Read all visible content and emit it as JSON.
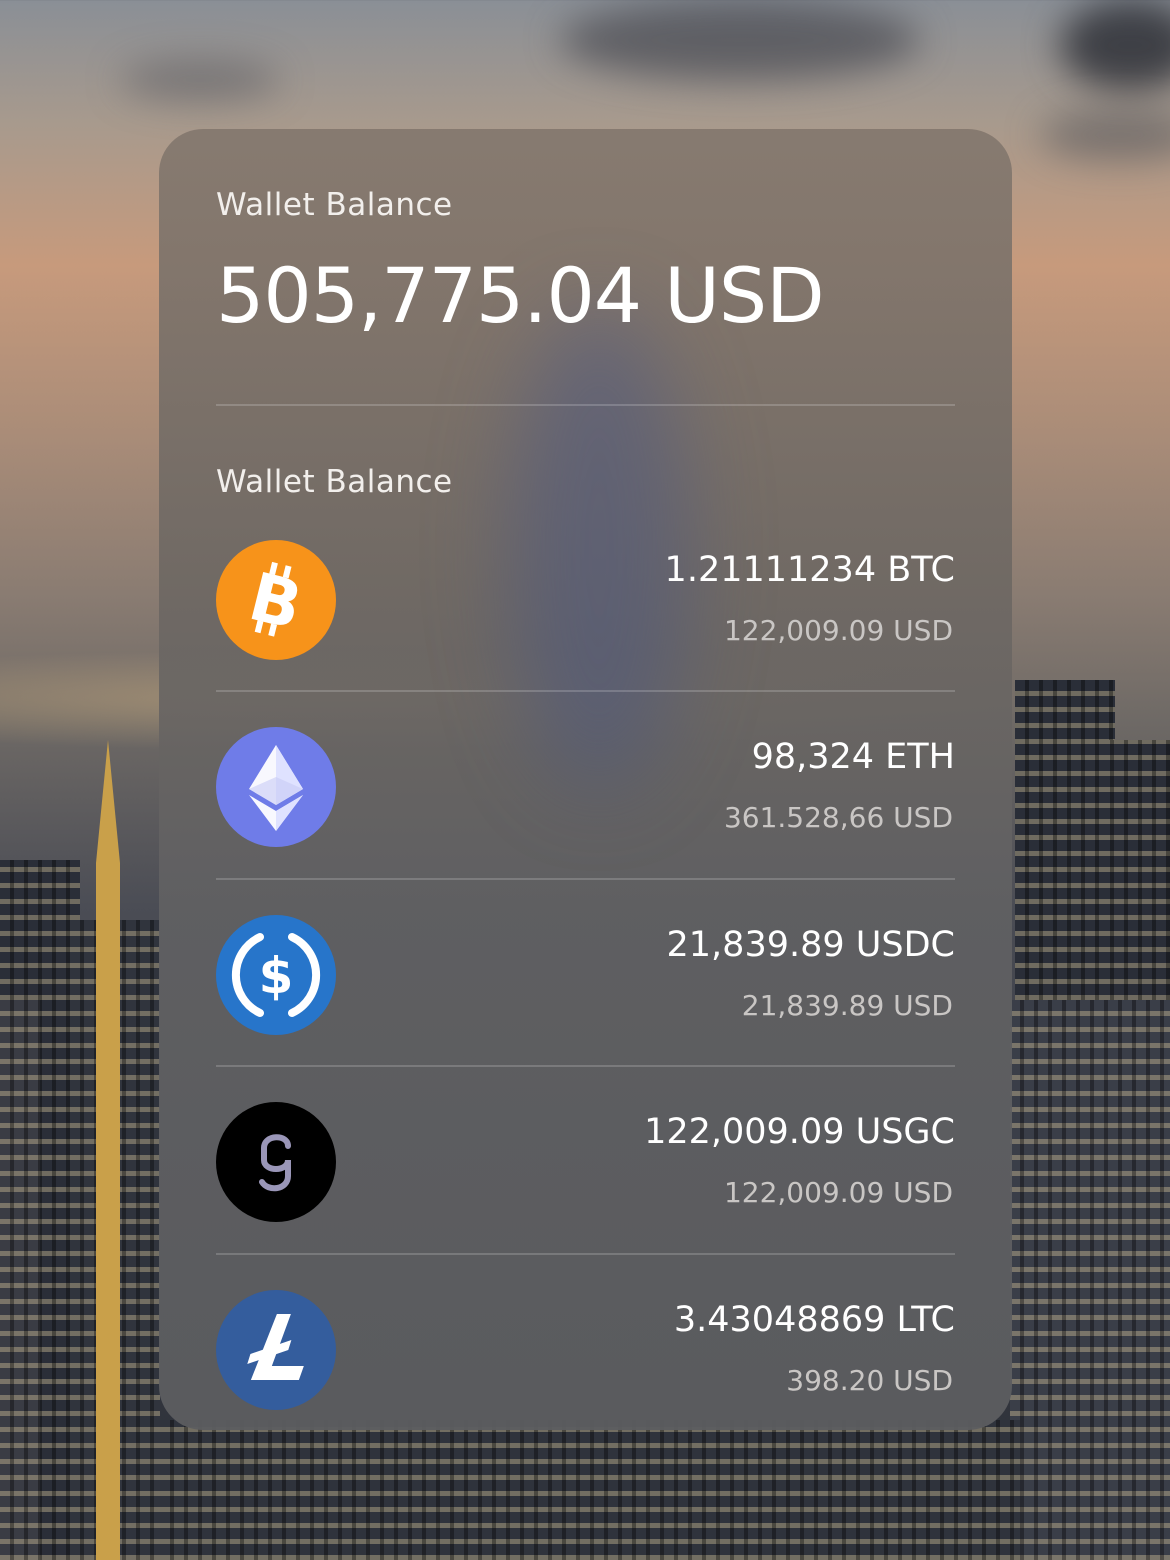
{
  "colors": {
    "btc": "#f7931a",
    "eth": "#6f7ce8",
    "usdc": "#2775ca",
    "usgc": "#000000",
    "ltc": "#345d9d"
  },
  "header": {
    "label": "Wallet Balance",
    "total": "505,775.04 USD"
  },
  "section": {
    "label": "Wallet Balance"
  },
  "coins": [
    {
      "icon": "bitcoin-icon",
      "amount": "1.21111234 BTC",
      "usd": "122,009.09 USD"
    },
    {
      "icon": "ethereum-icon",
      "amount": "98,324 ETH",
      "usd": "361.528,66 USD"
    },
    {
      "icon": "usdc-icon",
      "amount": "21,839.89 USDC",
      "usd": "21,839.89 USD"
    },
    {
      "icon": "usgc-icon",
      "amount": "122,009.09 USGC",
      "usd": "122,009.09 USD"
    },
    {
      "icon": "litecoin-icon",
      "amount": "3.43048869 LTC",
      "usd": "398.20 USD"
    }
  ]
}
